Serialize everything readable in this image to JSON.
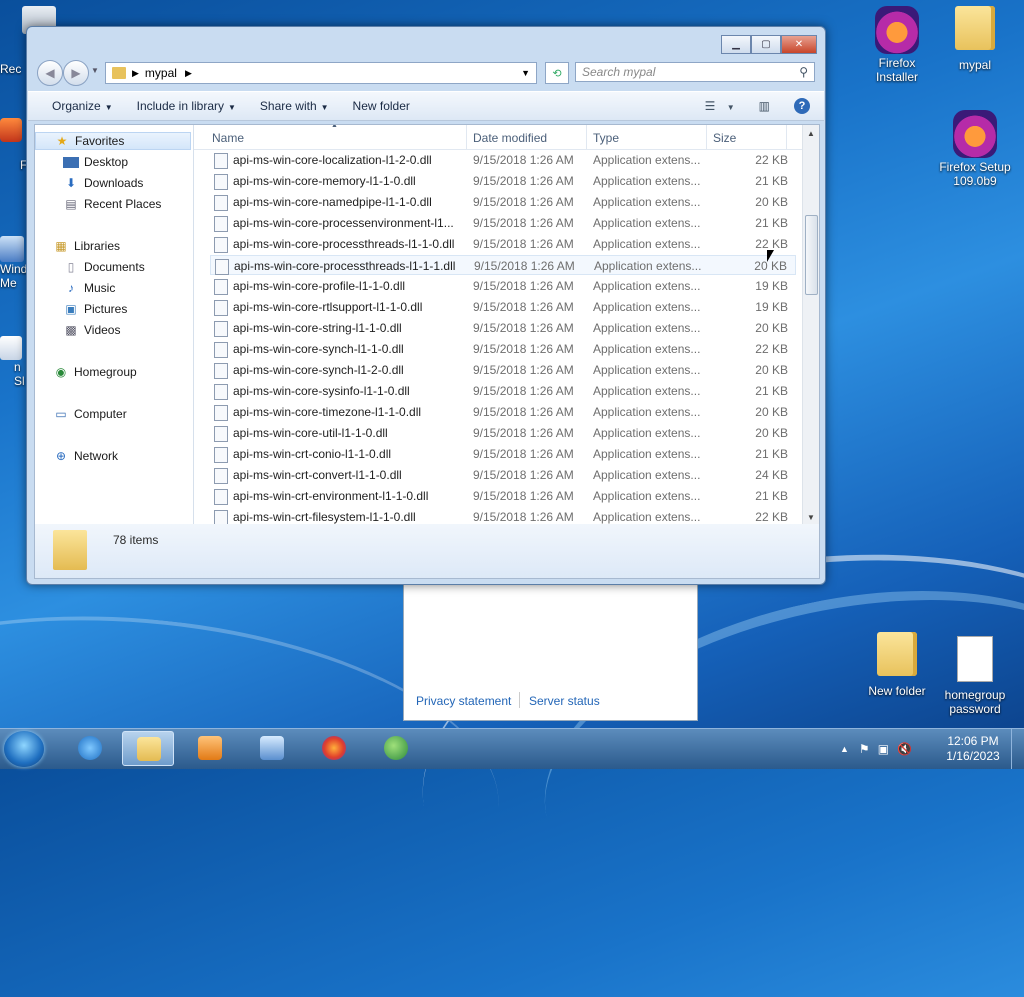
{
  "desktop": {
    "icons_right": [
      {
        "label": "Firefox Installer",
        "icon": "firefox-icon"
      },
      {
        "label": "mypal",
        "icon": "folder-icon"
      },
      {
        "label": "Firefox Setup 109.0b9",
        "icon": "firefox-icon"
      },
      {
        "label": "New folder",
        "icon": "folder-icon"
      },
      {
        "label": "homegroup password",
        "icon": "document-icon"
      }
    ],
    "edge_labels": [
      "Rec",
      "F",
      "Wind Me",
      "n Sl"
    ]
  },
  "explorer": {
    "address": {
      "folder": "mypal"
    },
    "search_placeholder": "Search mypal",
    "toolbar": {
      "organize": "Organize",
      "include_in_library": "Include in library",
      "share_with": "Share with",
      "new_folder": "New folder"
    },
    "nav": {
      "favorites": "Favorites",
      "desktop": "Desktop",
      "downloads": "Downloads",
      "recent_places": "Recent Places",
      "libraries": "Libraries",
      "documents": "Documents",
      "music": "Music",
      "pictures": "Pictures",
      "videos": "Videos",
      "homegroup": "Homegroup",
      "computer": "Computer",
      "network": "Network"
    },
    "columns": {
      "name": "Name",
      "date": "Date modified",
      "type": "Type",
      "size": "Size"
    },
    "files": [
      {
        "name": "api-ms-win-core-localization-l1-2-0.dll",
        "date": "9/15/2018 1:26 AM",
        "type": "Application extens...",
        "size": "22 KB"
      },
      {
        "name": "api-ms-win-core-memory-l1-1-0.dll",
        "date": "9/15/2018 1:26 AM",
        "type": "Application extens...",
        "size": "21 KB"
      },
      {
        "name": "api-ms-win-core-namedpipe-l1-1-0.dll",
        "date": "9/15/2018 1:26 AM",
        "type": "Application extens...",
        "size": "20 KB"
      },
      {
        "name": "api-ms-win-core-processenvironment-l1...",
        "date": "9/15/2018 1:26 AM",
        "type": "Application extens...",
        "size": "21 KB"
      },
      {
        "name": "api-ms-win-core-processthreads-l1-1-0.dll",
        "date": "9/15/2018 1:26 AM",
        "type": "Application extens...",
        "size": "22 KB"
      },
      {
        "name": "api-ms-win-core-processthreads-l1-1-1.dll",
        "date": "9/15/2018 1:26 AM",
        "type": "Application extens...",
        "size": "20 KB"
      },
      {
        "name": "api-ms-win-core-profile-l1-1-0.dll",
        "date": "9/15/2018 1:26 AM",
        "type": "Application extens...",
        "size": "19 KB"
      },
      {
        "name": "api-ms-win-core-rtlsupport-l1-1-0.dll",
        "date": "9/15/2018 1:26 AM",
        "type": "Application extens...",
        "size": "19 KB"
      },
      {
        "name": "api-ms-win-core-string-l1-1-0.dll",
        "date": "9/15/2018 1:26 AM",
        "type": "Application extens...",
        "size": "20 KB"
      },
      {
        "name": "api-ms-win-core-synch-l1-1-0.dll",
        "date": "9/15/2018 1:26 AM",
        "type": "Application extens...",
        "size": "22 KB"
      },
      {
        "name": "api-ms-win-core-synch-l1-2-0.dll",
        "date": "9/15/2018 1:26 AM",
        "type": "Application extens...",
        "size": "20 KB"
      },
      {
        "name": "api-ms-win-core-sysinfo-l1-1-0.dll",
        "date": "9/15/2018 1:26 AM",
        "type": "Application extens...",
        "size": "21 KB"
      },
      {
        "name": "api-ms-win-core-timezone-l1-1-0.dll",
        "date": "9/15/2018 1:26 AM",
        "type": "Application extens...",
        "size": "20 KB"
      },
      {
        "name": "api-ms-win-core-util-l1-1-0.dll",
        "date": "9/15/2018 1:26 AM",
        "type": "Application extens...",
        "size": "20 KB"
      },
      {
        "name": "api-ms-win-crt-conio-l1-1-0.dll",
        "date": "9/15/2018 1:26 AM",
        "type": "Application extens...",
        "size": "21 KB"
      },
      {
        "name": "api-ms-win-crt-convert-l1-1-0.dll",
        "date": "9/15/2018 1:26 AM",
        "type": "Application extens...",
        "size": "24 KB"
      },
      {
        "name": "api-ms-win-crt-environment-l1-1-0.dll",
        "date": "9/15/2018 1:26 AM",
        "type": "Application extens...",
        "size": "21 KB"
      },
      {
        "name": "api-ms-win-crt-filesystem-l1-1-0.dll",
        "date": "9/15/2018 1:26 AM",
        "type": "Application extens...",
        "size": "22 KB"
      }
    ],
    "status": {
      "count": "78 items"
    }
  },
  "dialog": {
    "privacy": "Privacy statement",
    "server_status": "Server status"
  },
  "taskbar": {
    "clock_time": "12:06 PM",
    "clock_date": "1/16/2023"
  }
}
